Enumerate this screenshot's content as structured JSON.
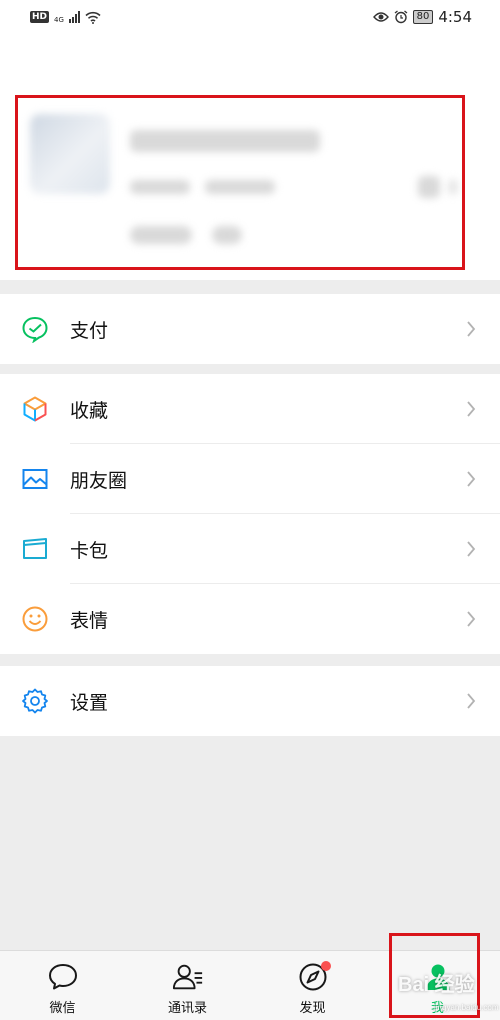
{
  "status_bar": {
    "hd_label": "HD",
    "network_label": "4G",
    "battery": "80",
    "time": "4:54"
  },
  "menu": {
    "pay": "支付",
    "favorites": "收藏",
    "moments": "朋友圈",
    "cards": "卡包",
    "stickers": "表情",
    "settings": "设置"
  },
  "tabs": [
    {
      "label": "微信",
      "icon": "chat-bubble-icon"
    },
    {
      "label": "通讯录",
      "icon": "contacts-icon"
    },
    {
      "label": "发现",
      "icon": "compass-icon",
      "badge": true
    },
    {
      "label": "我",
      "icon": "person-icon",
      "active": true
    }
  ],
  "watermark": {
    "main": "Bai 经验",
    "sub": "jingyan.baidu.com"
  },
  "colors": {
    "accent": "#07c160",
    "highlight": "#d9141a",
    "badge": "#fa5151"
  }
}
